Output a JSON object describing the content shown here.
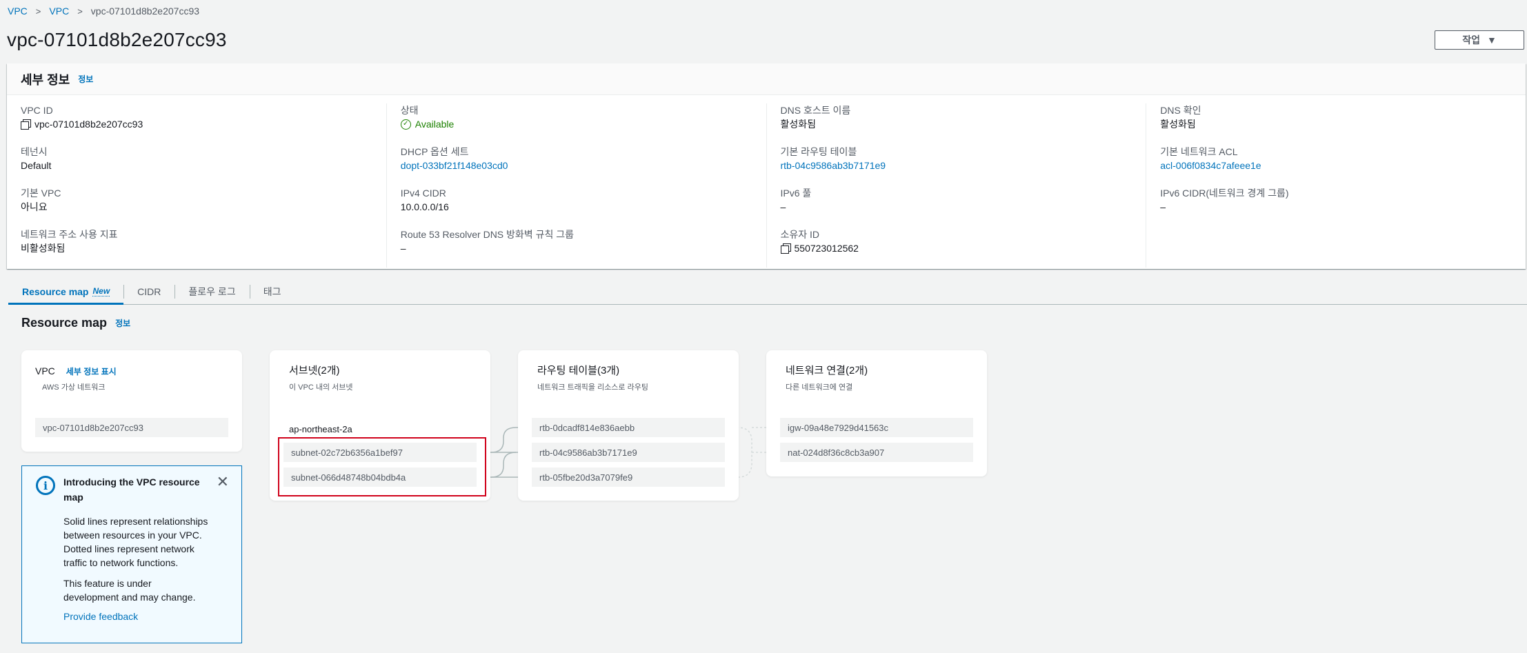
{
  "breadcrumb": {
    "root": "VPC",
    "section": "VPC",
    "current": "vpc-07101d8b2e207cc93"
  },
  "page": {
    "title": "vpc-07101d8b2e207cc93",
    "actions_label": "작업"
  },
  "details": {
    "heading": "세부 정보",
    "info_link": "정보",
    "columns": [
      [
        {
          "label": "VPC ID",
          "value": "vpc-07101d8b2e207cc93",
          "copy": true
        },
        {
          "label": "테넌시",
          "value": "Default"
        },
        {
          "label": "기본 VPC",
          "value": "아니요"
        },
        {
          "label": "네트워크 주소 사용 지표",
          "value": "비활성화됨"
        }
      ],
      [
        {
          "label": "상태",
          "value": "Available",
          "status": "ok"
        },
        {
          "label": "DHCP 옵션 세트",
          "value": "dopt-033bf21f148e03cd0",
          "link": true
        },
        {
          "label": "IPv4 CIDR",
          "value": "10.0.0.0/16"
        },
        {
          "label": "Route 53 Resolver DNS 방화벽 규칙 그룹",
          "value": "–"
        }
      ],
      [
        {
          "label": "DNS 호스트 이름",
          "value": "활성화됨"
        },
        {
          "label": "기본 라우팅 테이블",
          "value": "rtb-04c9586ab3b7171e9",
          "link": true
        },
        {
          "label": "IPv6 풀",
          "value": "–"
        },
        {
          "label": "소유자 ID",
          "value": "550723012562",
          "copy": true
        }
      ],
      [
        {
          "label": "DNS 확인",
          "value": "활성화됨"
        },
        {
          "label": "기본 네트워크 ACL",
          "value": "acl-006f0834c7afeee1e",
          "link": true
        },
        {
          "label": "IPv6 CIDR(네트워크 경계 그룹)",
          "value": "–"
        }
      ]
    ]
  },
  "tabs": [
    {
      "label": "Resource map",
      "badge": "New",
      "active": true
    },
    {
      "label": "CIDR"
    },
    {
      "label": "플로우 로그"
    },
    {
      "label": "태그"
    }
  ],
  "resource_map": {
    "title": "Resource map",
    "info_link": "정보",
    "vpc": {
      "title": "VPC",
      "details_link": "세부 정보 표시",
      "subtitle": "AWS 가상 네트워크",
      "id": "vpc-07101d8b2e207cc93"
    },
    "subnets": {
      "title": "서브넷(2개)",
      "subtitle": "이 VPC 내의 서브넷",
      "az": "ap-northeast-2a",
      "items": [
        "subnet-02c72b6356a1bef97",
        "subnet-066d48748b04bdb4a"
      ]
    },
    "route_tables": {
      "title": "라우팅 테이블(3개)",
      "subtitle": "네트워크 트래픽을 리소스로 라우팅",
      "items": [
        "rtb-0dcadf814e836aebb",
        "rtb-04c9586ab3b7171e9",
        "rtb-05fbe20d3a7079fe9"
      ]
    },
    "connections": {
      "title": "네트워크 연결(2개)",
      "subtitle": "다른 네트워크에 연결",
      "items": [
        "igw-09a48e7929d41563c",
        "nat-024d8f36c8cb3a907"
      ]
    }
  },
  "intro": {
    "title": "Introducing the VPC resource map",
    "p1": "Solid lines represent relationships between resources in your VPC. Dotted lines represent network traffic to network functions.",
    "p2": "This feature is under development and may change.",
    "feedback": "Provide feedback"
  },
  "colors": {
    "link": "#0073bb",
    "ok": "#1d8102",
    "highlight": "#d0021b"
  }
}
